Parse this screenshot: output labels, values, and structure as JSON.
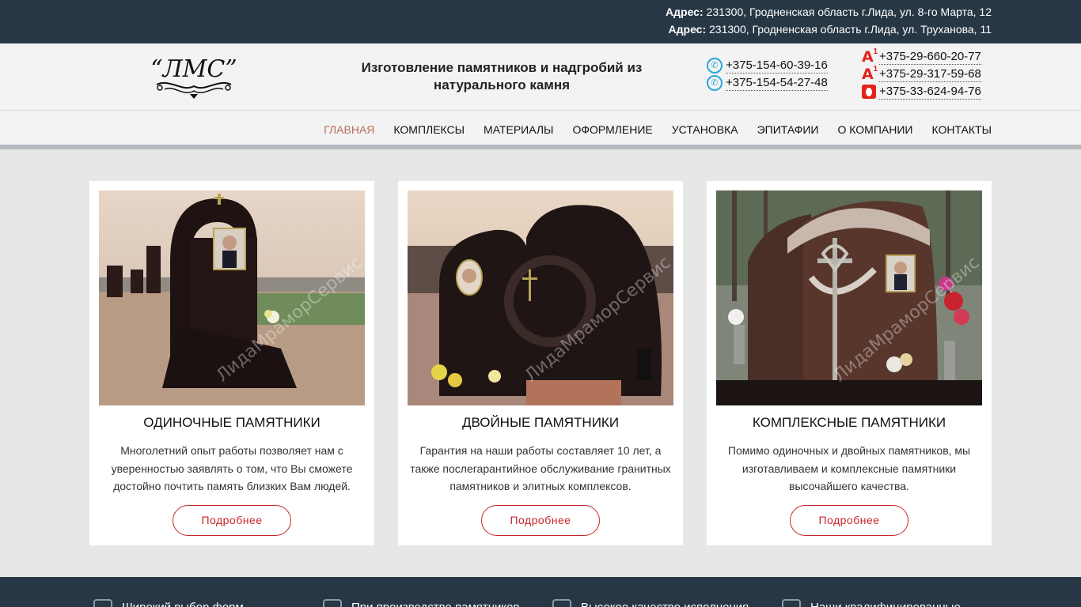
{
  "topbar": {
    "addresses": [
      {
        "label": "Адрес:",
        "text": "231300, Гродненская область г.Лида, ул. 8-го Марта, 12"
      },
      {
        "label": "Адрес:",
        "text": "231300, Гродненская область г.Лида, ул. Труханова, 11"
      }
    ]
  },
  "header": {
    "logo_text": "“ЛМС”",
    "tagline": "Изготовление памятников и надгробий из натурального камня",
    "phones_landline": [
      {
        "icon": "viber-icon",
        "number": "+375-154-60-39-16"
      },
      {
        "icon": "viber-icon",
        "number": "+375-154-54-27-48"
      }
    ],
    "phones_mobile": [
      {
        "icon": "a1-operator-icon",
        "number": "+375-29-660-20-77"
      },
      {
        "icon": "a1-operator-icon",
        "number": "+375-29-317-59-68"
      },
      {
        "icon": "mts-operator-icon",
        "number": "+375-33-624-94-76"
      }
    ]
  },
  "nav": {
    "items": [
      {
        "label": "ГЛАВНАЯ",
        "active": true
      },
      {
        "label": "КОМПЛЕКСЫ"
      },
      {
        "label": "МАТЕРИАЛЫ"
      },
      {
        "label": "ОФОРМЛЕНИЕ"
      },
      {
        "label": "УСТАНОВКА"
      },
      {
        "label": "ЭПИТАФИИ"
      },
      {
        "label": "О КОМПАНИИ"
      },
      {
        "label": "КОНТАКТЫ"
      }
    ]
  },
  "cards": [
    {
      "title": "ОДИНОЧНЫЕ ПАМЯТНИКИ",
      "desc": "Многолетний опыт работы позволяет нам с уверенностью заявлять о том, что Вы сможете достойно почтить память близких Вам людей.",
      "button": "Подробнее",
      "watermark": "ЛидаМраморСервис"
    },
    {
      "title": "ДВОЙНЫЕ ПАМЯТНИКИ",
      "desc": "Гарантия на наши работы составляет 10 лет, а также послегарантийное обслуживание гранитных памятников и элитных комплексов.",
      "button": "Подробнее",
      "watermark": "ЛидаМраморСервис"
    },
    {
      "title": "КОМПЛЕКСНЫЕ ПАМЯТНИКИ",
      "desc": "Помимо одиночных и двойных памятников, мы изготавливаем и комплексные памятники высочайшего качества.",
      "button": "Подробнее",
      "watermark": "ЛидаМраморСервис"
    }
  ],
  "features": [
    {
      "icon": "shapes-icon",
      "text": "Широкий выбор форм"
    },
    {
      "icon": "people-icon",
      "text": "При производстве памятников"
    },
    {
      "icon": "quality-icon",
      "text": "Высокое качество исполнения"
    },
    {
      "icon": "specialists-icon",
      "text": "Наши квалифицированные"
    }
  ],
  "colors": {
    "topbar": "#283745",
    "accent": "#c8262a",
    "nav_active": "#b76e5a"
  }
}
